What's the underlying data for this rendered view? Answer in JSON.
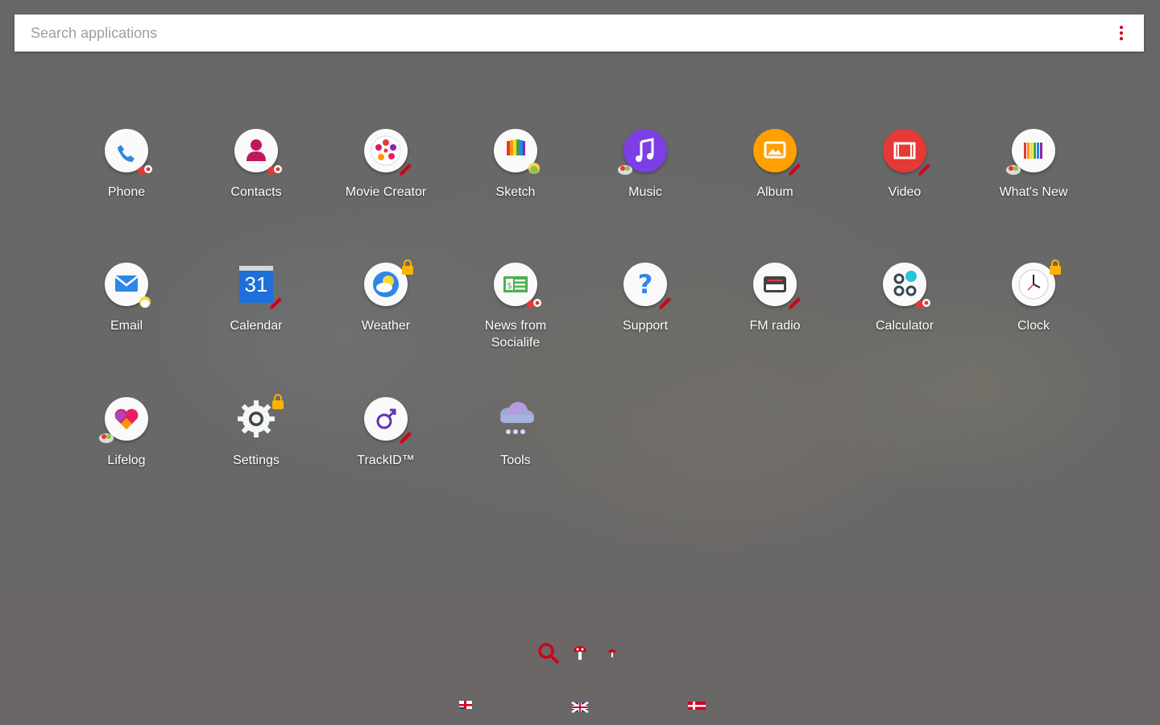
{
  "search": {
    "placeholder": "Search applications"
  },
  "apps": {
    "phone": "Phone",
    "contacts": "Contacts",
    "movie_creator": "Movie Creator",
    "sketch": "Sketch",
    "music": "Music",
    "album": "Album",
    "video": "Video",
    "whats_new": "What's New",
    "email": "Email",
    "calendar": "Calendar",
    "calendar_day": "31",
    "weather": "Weather",
    "news": "News from\nSocialife",
    "support": "Support",
    "fm_radio": "FM radio",
    "calculator": "Calculator",
    "clock": "Clock",
    "lifelog": "Lifelog",
    "settings": "Settings",
    "trackid": "TrackID™",
    "tools": "Tools"
  },
  "colors": {
    "accent": "#d0021b",
    "background": "#6b6b6b"
  }
}
